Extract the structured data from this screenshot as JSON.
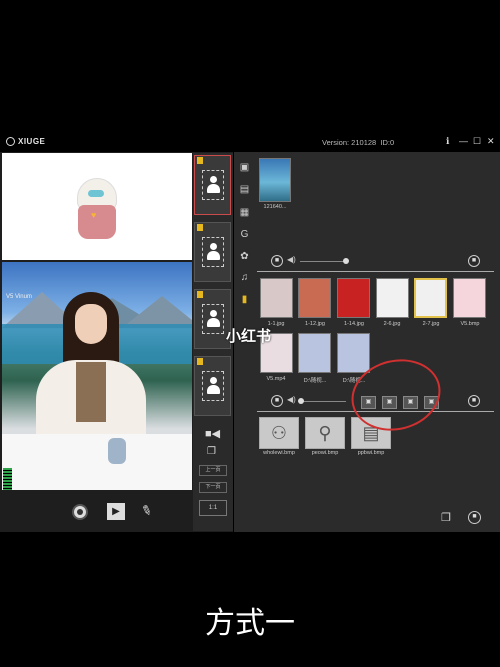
{
  "window": {
    "brand": "XIUGE",
    "version": "Version: 210128",
    "id": "ID:0",
    "controls": [
      "ℹ",
      "—",
      "☐",
      "✕"
    ]
  },
  "preview": {
    "caption": "V5 Vinum"
  },
  "strip": {
    "next_label": "上一页",
    "prev_label": "下一页",
    "ratio_label": "1:1"
  },
  "gallery_top": {
    "items": [
      {
        "label": "121640..."
      }
    ]
  },
  "gallery_images": {
    "items": [
      {
        "label": "1-1.jpg"
      },
      {
        "label": "1-12.jpg"
      },
      {
        "label": "1-14.jpg"
      },
      {
        "label": "2-6.jpg"
      },
      {
        "label": "2-7.jpg"
      },
      {
        "label": "V5.bmp"
      },
      {
        "label": "V5.mp4"
      },
      {
        "label": "D:\\随视..."
      },
      {
        "label": "D:\\随视..."
      }
    ]
  },
  "cards": {
    "items": [
      {
        "label": "wholewi.bmp"
      },
      {
        "label": "peowi.bmp"
      },
      {
        "label": "ppbwi.bmp"
      }
    ]
  },
  "watermark": "小红书",
  "caption": "方式一",
  "colors": {
    "accent_selected": "#e2c24a",
    "annotation": "#d03030",
    "active_thumb": "#c94b4b"
  }
}
